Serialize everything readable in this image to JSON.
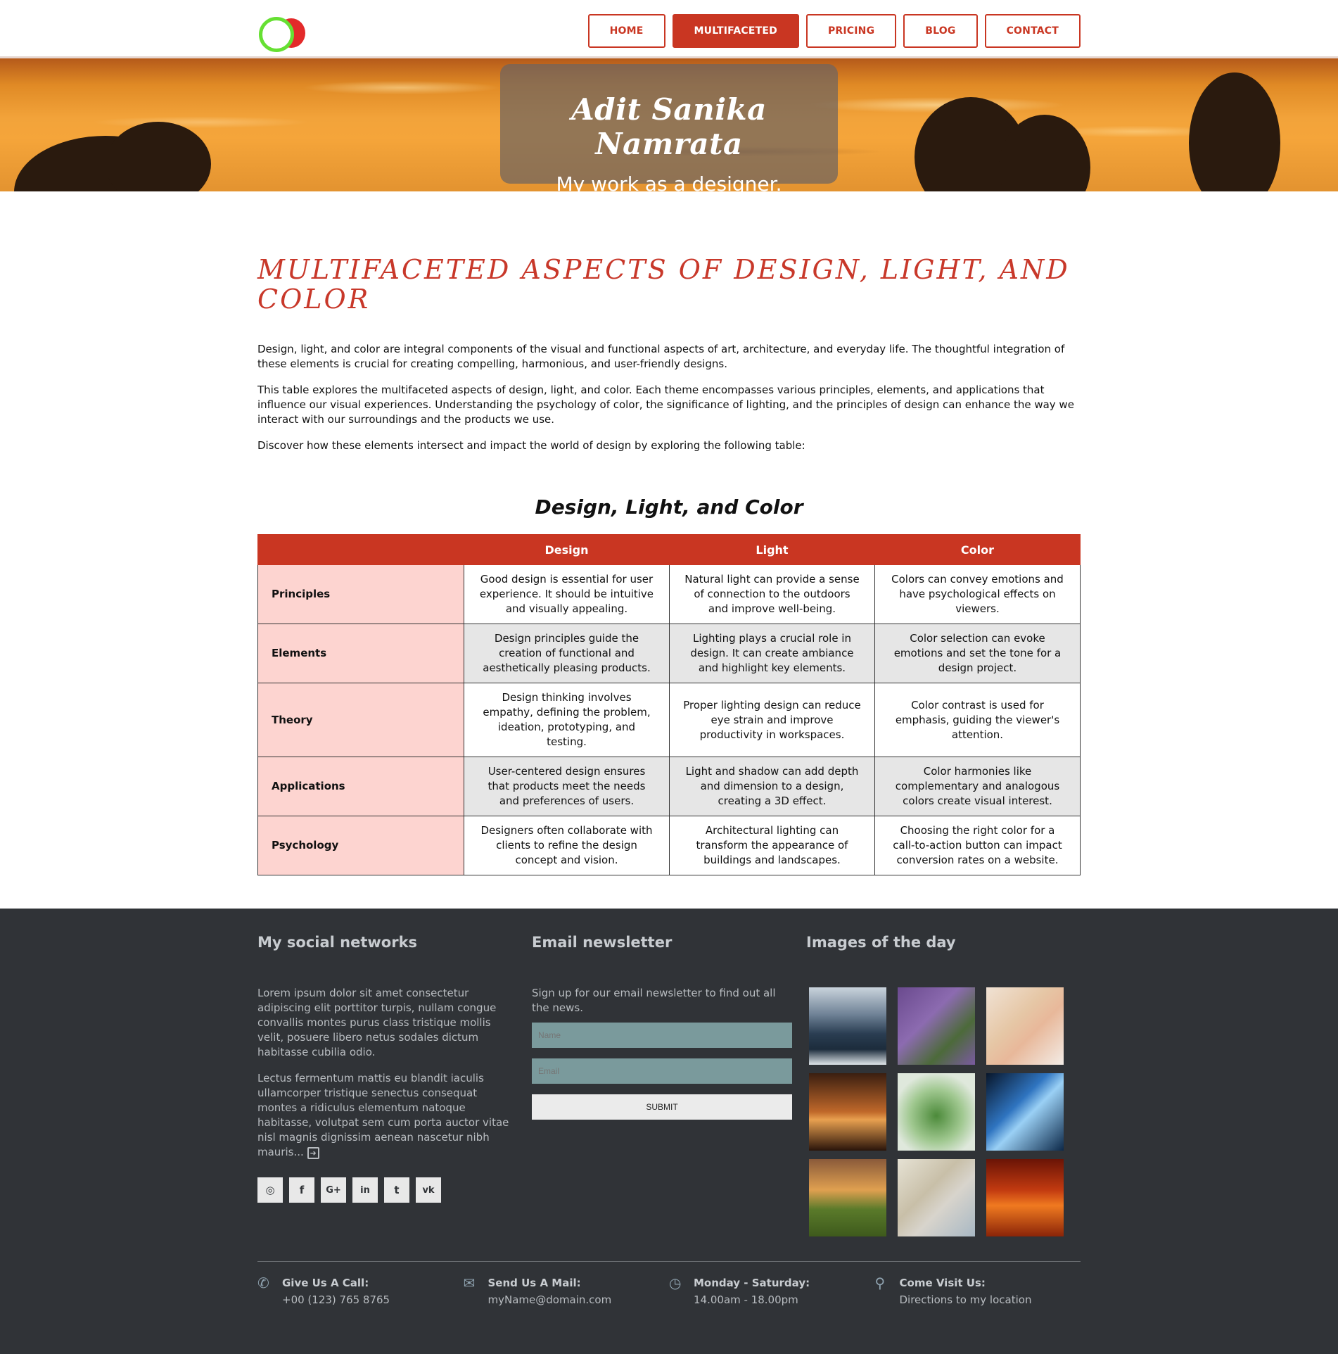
{
  "colors": {
    "brand": "#c93622",
    "footer_bg": "#303337",
    "rowhead_bg": "#fdd4d0"
  },
  "nav": {
    "logo_icon": "overlapping-circles-logo",
    "items": [
      {
        "label": "HOME"
      },
      {
        "label": "MULTIFACETED",
        "active": true
      },
      {
        "label": "PRICING"
      },
      {
        "label": "BLOG"
      },
      {
        "label": "CONTACT"
      }
    ]
  },
  "hero": {
    "title": "Adit Sanika Namrata",
    "subtitle": "My work as a designer."
  },
  "main": {
    "title": "MULTIFACETED ASPECTS OF DESIGN, LIGHT, AND COLOR",
    "paragraphs": [
      "Design, light, and color are integral components of the visual and functional aspects of art, architecture, and everyday life. The thoughtful integration of these elements is crucial for creating compelling, harmonious, and user-friendly designs.",
      "This table explores the multifaceted aspects of design, light, and color. Each theme encompasses various principles, elements, and applications that influence our visual experiences. Understanding the psychology of color, the significance of lighting, and the principles of design can enhance the way we interact with our surroundings and the products we use.",
      "Discover how these elements intersect and impact the world of design by exploring the following table:"
    ],
    "table": {
      "title": "Design, Light, and Color",
      "headers": [
        "",
        "Design",
        "Light",
        "Color"
      ],
      "rows": [
        [
          "Principles",
          "Good design is essential for user experience. It should be intuitive and visually appealing.",
          "Natural light can provide a sense of connection to the outdoors and improve well-being.",
          "Colors can convey emotions and have psychological effects on viewers."
        ],
        [
          "Elements",
          "Design principles guide the creation of functional and aesthetically pleasing products.",
          "Lighting plays a crucial role in design. It can create ambiance and highlight key elements.",
          "Color selection can evoke emotions and set the tone for a design project."
        ],
        [
          "Theory",
          "Design thinking involves empathy, defining the problem, ideation, prototyping, and testing.",
          "Proper lighting design can reduce eye strain and improve productivity in workspaces.",
          "Color contrast is used for emphasis, guiding the viewer's attention."
        ],
        [
          "Applications",
          "User-centered design ensures that products meet the needs and preferences of users.",
          "Light and shadow can add depth and dimension to a design, creating a 3D effect.",
          "Color harmonies like complementary and analogous colors create visual interest."
        ],
        [
          "Psychology",
          "Designers often collaborate with clients to refine the design concept and vision.",
          "Architectural lighting can transform the appearance of buildings and landscapes.",
          "Choosing the right color for a call-to-action button can impact conversion rates on a website."
        ]
      ]
    }
  },
  "footer": {
    "social": {
      "heading": "My social networks",
      "p1": "Lorem ipsum dolor sit amet consectetur adipiscing elit porttitor turpis, nullam congue convallis montes purus class tristique mollis velit, posuere libero netus sodales dictum habitasse cubilia odio.",
      "p2": "Lectus fermentum mattis eu blandit iaculis ullamcorper tristique senectus consequat montes a ridiculus elementum natoque habitasse, volutpat sem cum porta auctor vitae nisl magnis dignissim aenean nascetur nibh mauris...",
      "more_icon": "arrow-right-square-icon",
      "icons": [
        {
          "name": "dribbble-icon",
          "glyph": "◎"
        },
        {
          "name": "facebook-icon",
          "glyph": "f"
        },
        {
          "name": "google-plus-icon",
          "glyph": "G+"
        },
        {
          "name": "linkedin-icon",
          "glyph": "in"
        },
        {
          "name": "twitter-icon",
          "glyph": "t"
        },
        {
          "name": "vk-icon",
          "glyph": "vk"
        }
      ]
    },
    "newsletter": {
      "heading": "Email newsletter",
      "text": "Sign up for our email newsletter to find out all the news.",
      "name_placeholder": "Name",
      "email_placeholder": "Email",
      "submit_label": "SUBMIT"
    },
    "images": {
      "heading": "Images of the day",
      "tiles": [
        {
          "name": "image-sea",
          "bg": "linear-gradient(180deg,#c9d3dc 0%,#6f8296 35%,#2a3d52 60%,#1c2c3c 80%,#e0e6ea 100%)"
        },
        {
          "name": "image-lavender",
          "bg": "linear-gradient(135deg,#6a4a8e,#8c6bb0 40%,#4c6a3a 70%,#7a5aa0)"
        },
        {
          "name": "image-desk-phone",
          "bg": "linear-gradient(135deg,#f0e2d4,#e6c7a6 40%,#e8b89a 60%,#f3ece6)"
        },
        {
          "name": "image-forest-sunset",
          "bg": "linear-gradient(180deg,#3a1e10,#c0682a 50%,#e8a050 60%,#2a140a)"
        },
        {
          "name": "image-terrarium",
          "bg": "radial-gradient(circle at 50% 55%,#4c8a3a,#a0c890 45%,#dfe8dc 75%)"
        },
        {
          "name": "image-light-trails",
          "bg": "linear-gradient(135deg,#08162a,#2f74c0 40%,#9ad0f5 55%,#0c2848)"
        },
        {
          "name": "image-field-sunset",
          "bg": "linear-gradient(180deg,#8a5a3a,#e0a050 40%,#5a7a2a 65%,#3e5a1c)"
        },
        {
          "name": "image-building",
          "bg": "linear-gradient(135deg,#e6e2d4,#c8bfa8 40%,#d8d4cc 60%,#a8b8c4)"
        },
        {
          "name": "image-red-sky",
          "bg": "linear-gradient(180deg,#6a1406,#c23a10 40%,#f07a20 60%,#8a2408)"
        }
      ]
    },
    "contact": [
      {
        "icon": "phone-icon",
        "glyph": "✆",
        "label": "Give Us A Call:",
        "value": "+00 (123) 765 8765"
      },
      {
        "icon": "envelope-icon",
        "glyph": "✉",
        "label": "Send Us A Mail:",
        "value": "myName@domain.com"
      },
      {
        "icon": "clock-icon",
        "glyph": "◷",
        "label": "Monday - Saturday:",
        "value": "14.00am - 18.00pm"
      },
      {
        "icon": "map-pin-icon",
        "glyph": "⚲",
        "label": "Come Visit Us:",
        "value": "Directions to my location"
      }
    ]
  }
}
